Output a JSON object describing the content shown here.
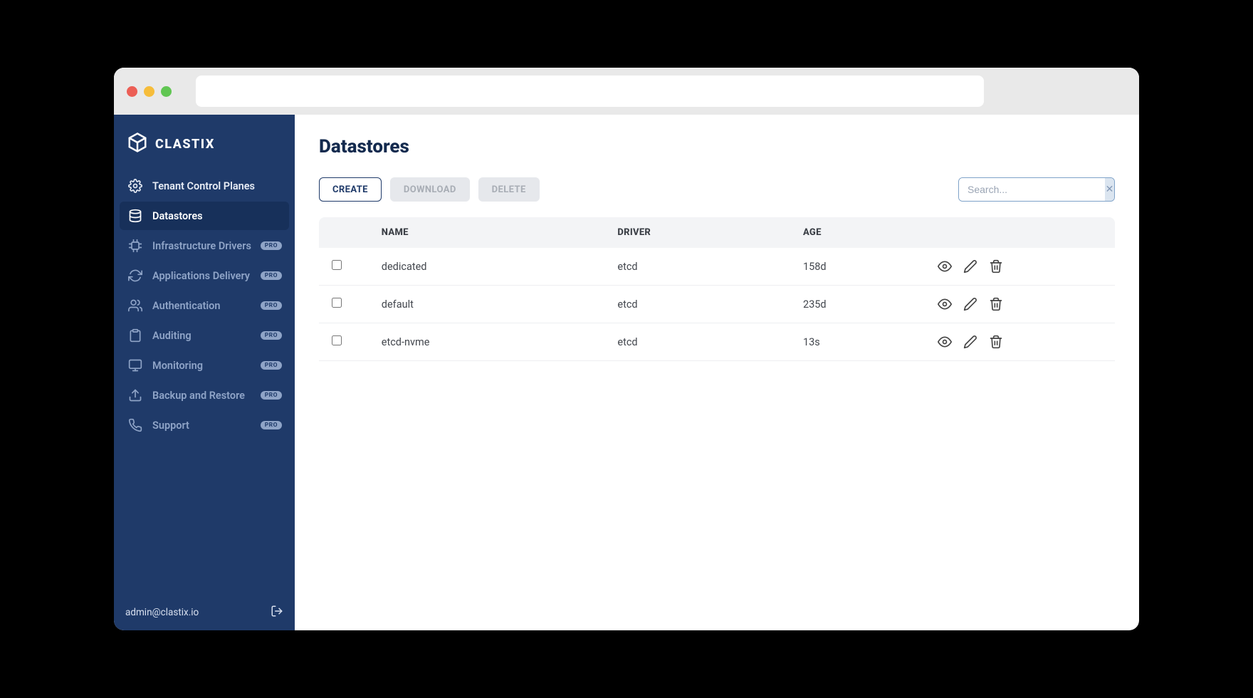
{
  "brand": {
    "name": "CLASTIX"
  },
  "sidebar": {
    "items": [
      {
        "label": "Tenant Control Planes",
        "icon": "gear-icon",
        "active": false,
        "pro": false,
        "dim": false
      },
      {
        "label": "Datastores",
        "icon": "database-icon",
        "active": true,
        "pro": false,
        "dim": false
      },
      {
        "label": "Infrastructure Drivers",
        "icon": "chip-icon",
        "active": false,
        "pro": true,
        "dim": true
      },
      {
        "label": "Applications Delivery",
        "icon": "refresh-icon",
        "active": false,
        "pro": true,
        "dim": true
      },
      {
        "label": "Authentication",
        "icon": "users-icon",
        "active": false,
        "pro": true,
        "dim": true
      },
      {
        "label": "Auditing",
        "icon": "clipboard-icon",
        "active": false,
        "pro": true,
        "dim": true
      },
      {
        "label": "Monitoring",
        "icon": "monitor-icon",
        "active": false,
        "pro": true,
        "dim": true
      },
      {
        "label": "Backup and Restore",
        "icon": "upload-icon",
        "active": false,
        "pro": true,
        "dim": true
      },
      {
        "label": "Support",
        "icon": "phone-icon",
        "active": false,
        "pro": true,
        "dim": true
      }
    ],
    "pro_badge": "PRO"
  },
  "footer": {
    "user": "admin@clastix.io"
  },
  "page": {
    "title": "Datastores"
  },
  "toolbar": {
    "create": "CREATE",
    "download": "DOWNLOAD",
    "delete": "DELETE"
  },
  "search": {
    "placeholder": "Search..."
  },
  "table": {
    "headers": {
      "name": "NAME",
      "driver": "DRIVER",
      "age": "AGE"
    },
    "rows": [
      {
        "name": "dedicated",
        "driver": "etcd",
        "age": "158d"
      },
      {
        "name": "default",
        "driver": "etcd",
        "age": "235d"
      },
      {
        "name": "etcd-nvme",
        "driver": "etcd",
        "age": "13s"
      }
    ]
  }
}
